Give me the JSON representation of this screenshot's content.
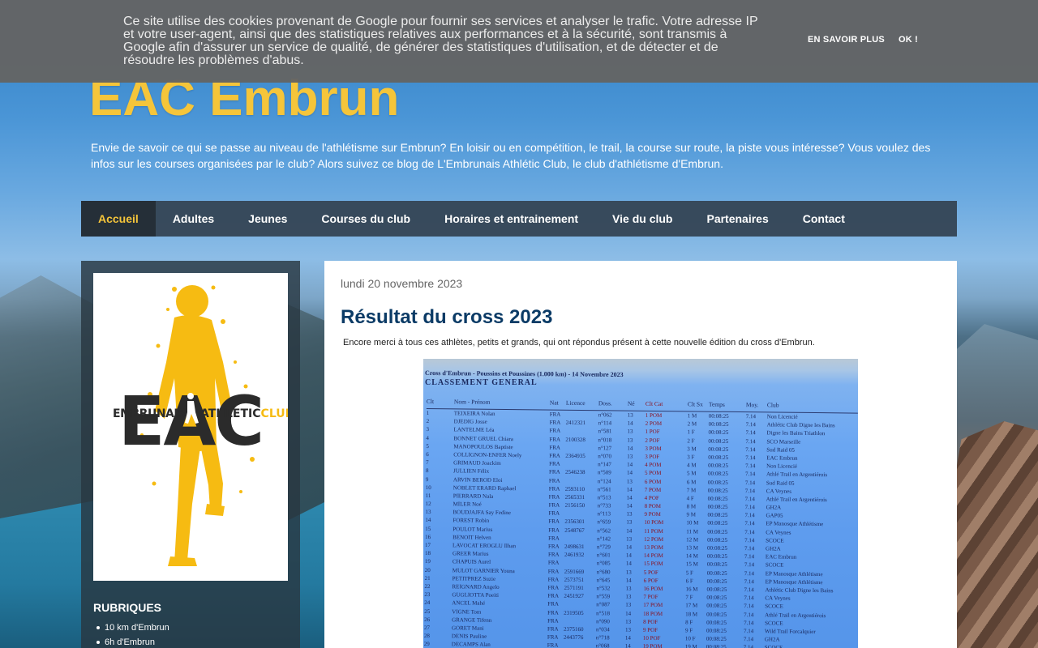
{
  "cookie": {
    "text": "Ce site utilise des cookies provenant de Google pour fournir ses services et analyser le trafic. Votre adresse IP et votre user-agent, ainsi que des statistiques relatives aux performances et à la sécurité, sont transmis à Google afin d'assurer un service de qualité, de générer des statistiques d'utilisation, et de détecter et de résoudre les problèmes d'abus.",
    "more_label": "EN SAVOIR PLUS",
    "ok_label": "OK !"
  },
  "header": {
    "title": "EAC Embrun",
    "description": "Envie de savoir ce qui se passe au niveau de l'athlétisme sur Embrun? En loisir ou en compétition, le trail, la course sur route, la piste vous intéresse? Vous voulez des infos sur les courses organisées par le club? Alors suivez ce blog de L'Embrunais Athlétic Club, le club d'athlétisme d'Embrun."
  },
  "nav": {
    "items": [
      "Accueil",
      "Adultes",
      "Jeunes",
      "Courses du club",
      "Horaires et entrainement",
      "Vie du club",
      "Partenaires",
      "Contact"
    ],
    "active": "Accueil"
  },
  "sidebar": {
    "logo": {
      "left_word": "EMBRUNAIS",
      "right_word": "ATHLETIC",
      "right_suffix": "CLUB",
      "big_letters": "EAC"
    },
    "heading": "RUBRIQUES",
    "items": [
      "10 km d'Embrun",
      "6h d'Embrun"
    ]
  },
  "post": {
    "date": "lundi 20 novembre 2023",
    "title": "Résultat du cross 2023",
    "intro": "Encore merci à tous ces athlètes, petits et grands, qui ont répondus présent à cette nouvelle édition du cross d'Embrun.",
    "photo": {
      "header": "Cross d'Embrun - Poussins et Poussines (1.000 km) - 14 Novembre 2023",
      "class_label": "CLASSEMENT GENERAL",
      "columns": [
        "Clt",
        "Nom - Prénom",
        "Nat",
        "Licence",
        "Doss.",
        "Né",
        "Clt Cat",
        "Clt Sx",
        "Temps",
        "Moy.",
        "Club"
      ],
      "rows": [
        [
          "1",
          "TEIXEIRA Nolan",
          "FRA",
          "",
          "n°062",
          "13",
          "1 POM",
          "1 M",
          "00:08:25",
          "7.14",
          "Non Licencié"
        ],
        [
          "2",
          "DJEDIG Josse",
          "FRA",
          "2412321",
          "n°114",
          "14",
          "2 POM",
          "2 M",
          "00:08:25",
          "7.14",
          "Athlétic Club Digne les Bains"
        ],
        [
          "3",
          "LANTELME Léa",
          "FRA",
          "",
          "n°581",
          "13",
          "1 POF",
          "1 F",
          "00:08:25",
          "7.14",
          "Digne les Bains Triathlon"
        ],
        [
          "4",
          "BONNET GRUEL Chiara",
          "FRA",
          "2100328",
          "n°018",
          "13",
          "2 POF",
          "2 F",
          "00:08:25",
          "7.14",
          "SCO Marseille"
        ],
        [
          "5",
          "MANOPOULOS Baptiste",
          "FRA",
          "",
          "n°127",
          "14",
          "3 POM",
          "3 M",
          "00:08:25",
          "7.14",
          "Sud Raid 05"
        ],
        [
          "6",
          "COLLIGNON-ENFER Noely",
          "FRA",
          "2364935",
          "n°070",
          "13",
          "3 POF",
          "3 F",
          "00:08:25",
          "7.14",
          "EAC Embrun"
        ],
        [
          "7",
          "GRIMAUD Joackim",
          "FRA",
          "",
          "n°147",
          "14",
          "4 POM",
          "4 M",
          "00:08:25",
          "7.14",
          "Non Licencié"
        ],
        [
          "8",
          "JULLIEN Félix",
          "FRA",
          "2546238",
          "n°509",
          "14",
          "5 POM",
          "5 M",
          "00:08:25",
          "7.14",
          "Athlé Trail en Argentiérois"
        ],
        [
          "9",
          "ARVIN BEROD Eloi",
          "FRA",
          "",
          "n°124",
          "13",
          "6 POM",
          "6 M",
          "00:08:25",
          "7.14",
          "Sud Raid 05"
        ],
        [
          "10",
          "NOBLET ERARD Raphael",
          "FRA",
          "2593110",
          "n°561",
          "14",
          "7 POM",
          "7 M",
          "00:08:25",
          "7.14",
          "CA Veynes"
        ],
        [
          "11",
          "PIERRARD Nala",
          "FRA",
          "2565331",
          "n°513",
          "14",
          "4 POF",
          "4 F",
          "00:08:25",
          "7.14",
          "Athlé Trail en Argentiérois"
        ],
        [
          "12",
          "MILER Noé",
          "FRA",
          "2156150",
          "n°733",
          "14",
          "8 POM",
          "8 M",
          "00:08:25",
          "7.14",
          "GH2A"
        ],
        [
          "13",
          "BOUDJAJFA Say Fedine",
          "FRA",
          "",
          "n°113",
          "13",
          "9 POM",
          "9 M",
          "00:08:25",
          "7.14",
          "GAP05"
        ],
        [
          "14",
          "FOREST Robin",
          "FRA",
          "2356301",
          "n°659",
          "13",
          "10 POM",
          "10 M",
          "00:08:25",
          "7.14",
          "EP Manosque Athlétisme"
        ],
        [
          "15",
          "POULOT Marius",
          "FRA",
          "2548767",
          "n°562",
          "14",
          "11 POM",
          "11 M",
          "00:08:25",
          "7.14",
          "CA Veynes"
        ],
        [
          "16",
          "BENOIT Helven",
          "FRA",
          "",
          "n°142",
          "13",
          "12 POM",
          "12 M",
          "00:08:25",
          "7.14",
          "SCOCE"
        ],
        [
          "17",
          "LAVOCAT EROGLU Ilhan",
          "FRA",
          "2498631",
          "n°729",
          "14",
          "13 POM",
          "13 M",
          "00:08:25",
          "7.14",
          "GH2A"
        ],
        [
          "18",
          "GREER Marius",
          "FRA",
          "2461932",
          "n°601",
          "14",
          "14 POM",
          "14 M",
          "00:08:25",
          "7.14",
          "EAC Embrun"
        ],
        [
          "19",
          "CHAPUIS Aurel",
          "FRA",
          "",
          "n°085",
          "14",
          "15 POM",
          "15 M",
          "00:08:25",
          "7.14",
          "SCOCE"
        ],
        [
          "20",
          "MULOT GARNIER Youna",
          "FRA",
          "2591669",
          "n°680",
          "13",
          "5 POF",
          "5 F",
          "00:08:25",
          "7.14",
          "EP Manosque Athlétisme"
        ],
        [
          "21",
          "PETITPREZ Suzie",
          "FRA",
          "2573751",
          "n°645",
          "14",
          "6 POF",
          "6 F",
          "00:08:25",
          "7.14",
          "EP Manosque Athlétisme"
        ],
        [
          "22",
          "REIGNARD Angelo",
          "FRA",
          "2571191",
          "n°532",
          "13",
          "16 POM",
          "16 M",
          "00:08:25",
          "7.14",
          "Athlétic Club Digne les Bains"
        ],
        [
          "23",
          "GUGLIOTTA Poeiti",
          "FRA",
          "2451927",
          "n°559",
          "13",
          "7 POF",
          "7 F",
          "00:08:25",
          "7.14",
          "CA Veynes"
        ],
        [
          "24",
          "ANCEL Mahé",
          "FRA",
          "",
          "n°087",
          "13",
          "17 POM",
          "17 M",
          "00:08:25",
          "7.14",
          "SCOCE"
        ],
        [
          "25",
          "VIGNE Tom",
          "FRA",
          "2319505",
          "n°518",
          "14",
          "18 POM",
          "18 M",
          "00:08:25",
          "7.14",
          "Athlé Trail en Argentiérois"
        ],
        [
          "26",
          "GRANGE Tifenn",
          "FRA",
          "",
          "n°090",
          "13",
          "8 POF",
          "8 F",
          "00:08:25",
          "7.14",
          "SCOCE"
        ],
        [
          "27",
          "GORET Mani",
          "FRA",
          "2375160",
          "n°034",
          "13",
          "9 POF",
          "9 F",
          "00:08:25",
          "7.14",
          "Wild Trail Forcalquier"
        ],
        [
          "28",
          "DENIS Pauline",
          "FRA",
          "2443776",
          "n°718",
          "14",
          "10 POF",
          "10 F",
          "00:08:25",
          "7.14",
          "GH2A"
        ],
        [
          "29",
          "DECAMPS Alan",
          "FRA",
          "",
          "n°068",
          "14",
          "19 POM",
          "19 M",
          "00:08:25",
          "7.14",
          "SCOCE"
        ]
      ]
    }
  },
  "colors": {
    "title_yellow": "#f5c53a",
    "nav_bg": "#323f4c",
    "post_title_blue": "#0b3b66",
    "logo_yellow": "#f6bb12",
    "logo_dark": "#2b2b2b"
  }
}
